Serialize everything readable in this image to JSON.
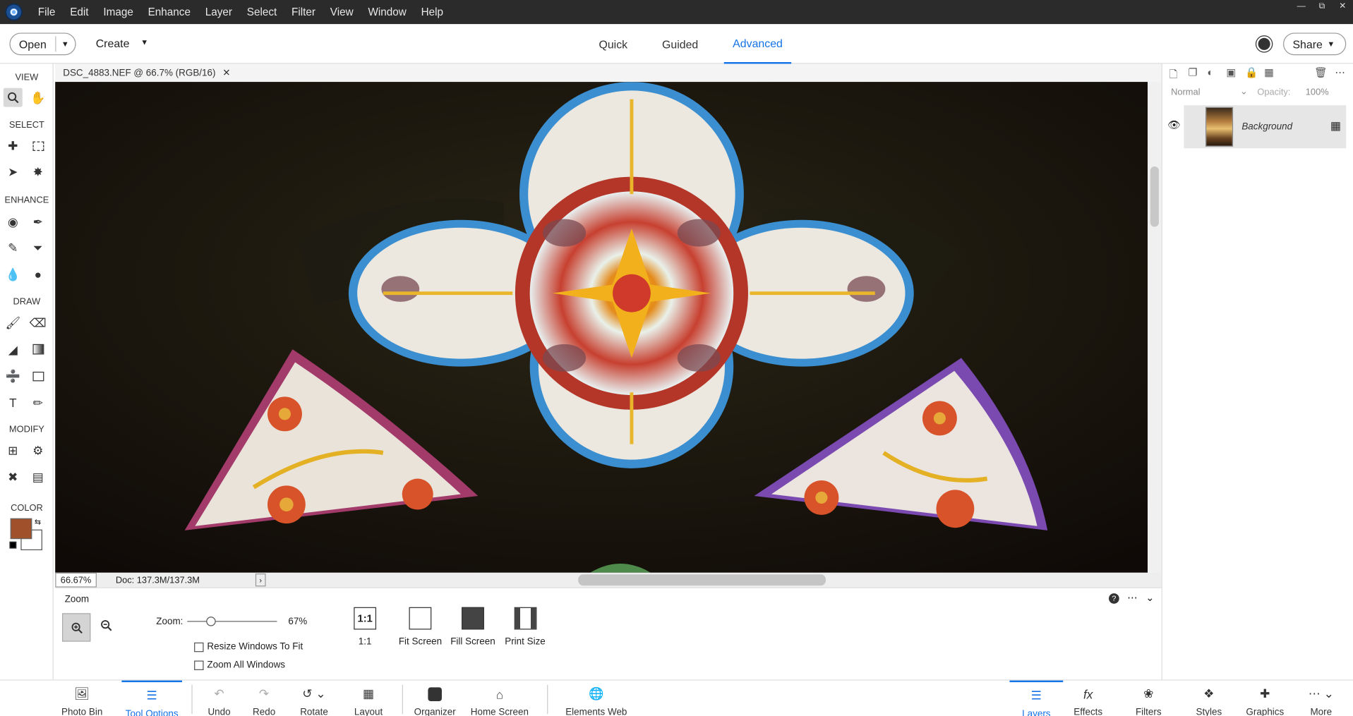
{
  "menubar": {
    "items": [
      "File",
      "Edit",
      "Image",
      "Enhance",
      "Layer",
      "Select",
      "Filter",
      "View",
      "Window",
      "Help"
    ]
  },
  "topbar": {
    "open_label": "Open",
    "create_label": "Create",
    "modes": [
      "Quick",
      "Guided",
      "Advanced"
    ],
    "active_mode": "Advanced",
    "share_label": "Share"
  },
  "toolbar": {
    "sections": [
      "VIEW",
      "SELECT",
      "ENHANCE",
      "DRAW",
      "MODIFY",
      "COLOR"
    ],
    "foreground_color": "#a0502a",
    "background_color": "#ffffff"
  },
  "document": {
    "tab_title": "DSC_4883.NEF @ 66.7% (RGB/16)",
    "zoom_percent": "66.67%",
    "doc_size": "Doc: 137.3M/137.3M"
  },
  "tool_options": {
    "tool_name": "Zoom",
    "zoom_label": "Zoom:",
    "zoom_value": "67%",
    "resize_windows": "Resize Windows To Fit",
    "zoom_all": "Zoom All Windows",
    "buttons": [
      "1:1",
      "Fit Screen",
      "Fill Screen",
      "Print Size"
    ],
    "one_to_one_icon": "1:1"
  },
  "layers_panel": {
    "blend_mode": "Normal",
    "opacity_label": "Opacity:",
    "opacity_value": "100%",
    "layer_name": "Background"
  },
  "bottombar": {
    "left": [
      "Photo Bin",
      "Tool Options",
      "Undo",
      "Redo",
      "Rotate",
      "Layout",
      "Organizer",
      "Home Screen",
      "Elements Web"
    ],
    "right": [
      "Layers",
      "Effects",
      "Filters",
      "Styles",
      "Graphics",
      "More"
    ],
    "active_left": "Tool Options",
    "active_right": "Layers"
  },
  "colors": {
    "accent": "#1473e6",
    "menubar_bg": "#2b2b2b"
  }
}
